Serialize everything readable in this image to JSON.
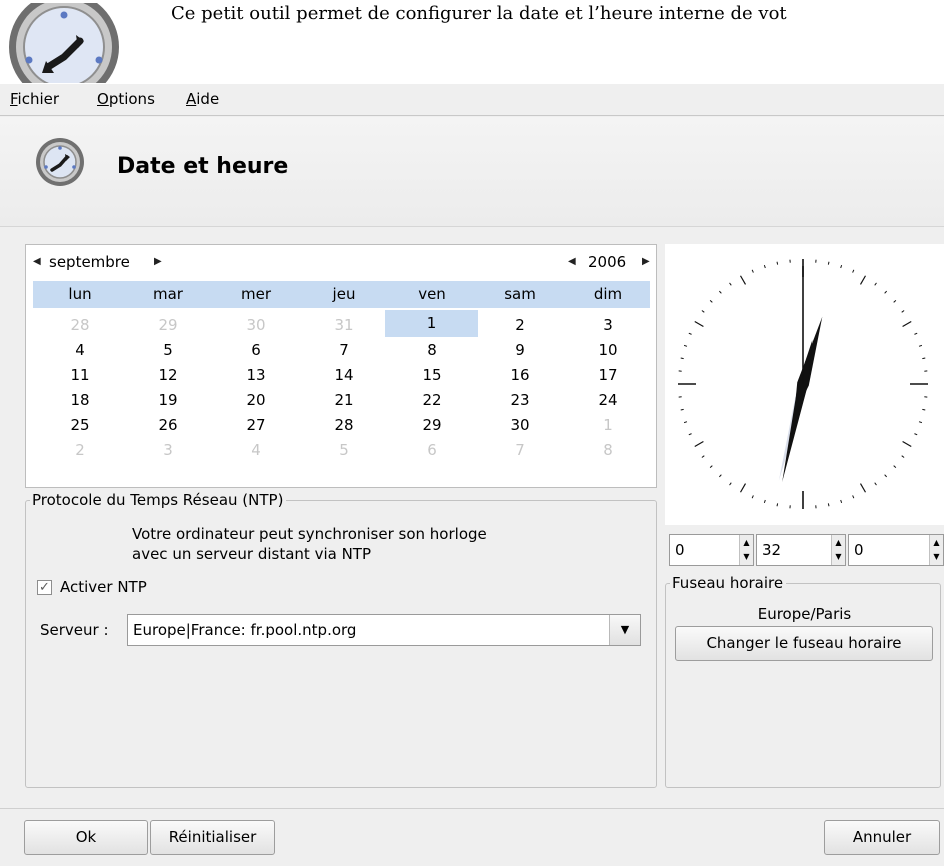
{
  "document": {
    "intro_text": "Ce petit outil permet de configurer la date et l’heure interne de vot"
  },
  "menubar": {
    "items": [
      {
        "mnemonic": "F",
        "rest": "ichier"
      },
      {
        "mnemonic": "O",
        "rest": "ptions"
      },
      {
        "mnemonic": "A",
        "rest": "ide"
      }
    ]
  },
  "header": {
    "title": "Date et heure",
    "icon": "clock-icon"
  },
  "calendar": {
    "month": "septembre",
    "year": "2006",
    "weekdays": [
      "lun",
      "mar",
      "mer",
      "jeu",
      "ven",
      "sam",
      "dim"
    ],
    "weeks": [
      [
        "28",
        "29",
        "30",
        "31",
        "1",
        "2",
        "3"
      ],
      [
        "4",
        "5",
        "6",
        "7",
        "8",
        "9",
        "10"
      ],
      [
        "11",
        "12",
        "13",
        "14",
        "15",
        "16",
        "17"
      ],
      [
        "18",
        "19",
        "20",
        "21",
        "22",
        "23",
        "24"
      ],
      [
        "25",
        "26",
        "27",
        "28",
        "29",
        "30",
        "1"
      ],
      [
        "2",
        "3",
        "4",
        "5",
        "6",
        "7",
        "8"
      ]
    ],
    "selected_day": "1",
    "colors": {
      "header_bg": "#c7dbf2",
      "selected_bg": "#c7dbf2",
      "muted_text": "#c7c7c7"
    }
  },
  "ntp": {
    "group_title": "Protocole du Temps Réseau (NTP)",
    "description_line1": "Votre ordinateur peut synchroniser son horloge",
    "description_line2": "avec un serveur distant via NTP",
    "enable_label": "Activer NTP",
    "enabled": true,
    "server_label": "Serveur :",
    "server_value": "Europe|France: fr.pool.ntp.org"
  },
  "clock": {
    "hours": 0,
    "minutes": 32,
    "seconds": 0
  },
  "time_fields": {
    "hours": "0",
    "minutes": "32",
    "seconds": "0"
  },
  "timezone": {
    "group_title": "Fuseau horaire",
    "value": "Europe/Paris",
    "change_button": "Changer le fuseau horaire"
  },
  "footer": {
    "ok": "Ok",
    "reset": "Réinitialiser",
    "cancel": "Annuler"
  }
}
